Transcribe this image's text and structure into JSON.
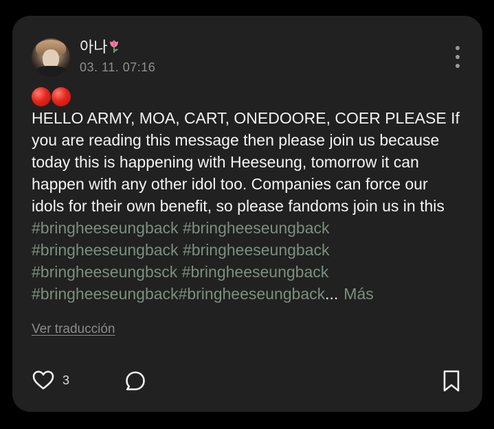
{
  "post": {
    "username": "아나",
    "username_emoji": "tulip-icon",
    "timestamp": "03. 11. 07:16",
    "emoji_prefix": [
      "red-circle-icon",
      "red-circle-icon"
    ],
    "body_text": "HELLO ARMY, MOA, CART, ONEDOORE, COER PLEASE If you are reading this message then please join us because today this is happening with Heeseung, tomorrow it can happen with any other idol too. Companies can force our idols for their own benefit, so please fandoms join us in this",
    "hashtags": [
      "#bringheeseungback",
      "#bringheeseungback",
      "#bringheeseungback",
      "#bringheeseungback",
      "#bringheeseungbsck",
      "#bringheeseungback",
      "#bringheeseungback",
      "#bringheeseungback"
    ],
    "ellipsis": "...",
    "more_label": "Más",
    "translate_label": "Ver traducción"
  },
  "actions": {
    "like_count": "3",
    "like_icon": "heart-icon",
    "comment_icon": "comment-icon",
    "bookmark_icon": "bookmark-icon",
    "more_icon": "more-vertical-icon"
  },
  "colors": {
    "background": "#000000",
    "card": "#212121",
    "text": "#f4f4f4",
    "muted": "#8f8f8f",
    "hashtag": "#7c8f7e"
  }
}
